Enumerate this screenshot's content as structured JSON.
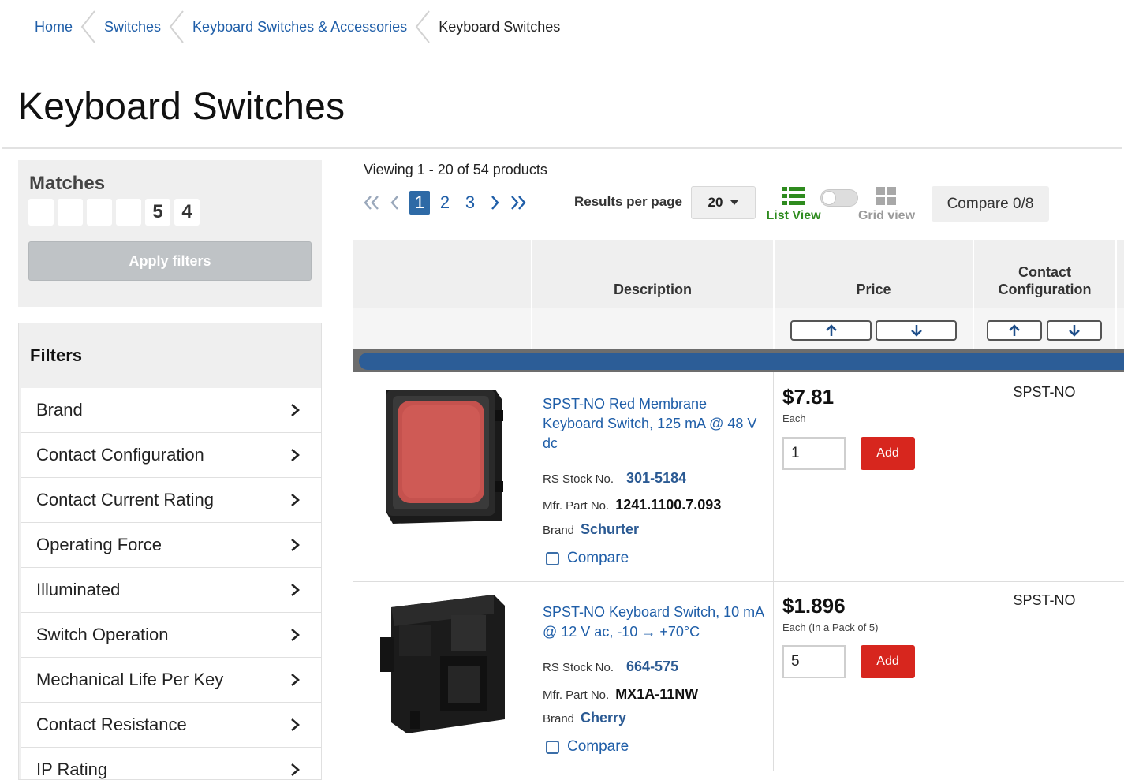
{
  "breadcrumb": {
    "items": [
      "Home",
      "Switches",
      "Keyboard Switches & Accessories"
    ],
    "current": "Keyboard Switches"
  },
  "page_title": "Keyboard Switches",
  "matches": {
    "label": "Matches",
    "digits": [
      "",
      "",
      "",
      "",
      "5",
      "4"
    ],
    "apply_label": "Apply filters"
  },
  "filters": {
    "title": "Filters",
    "items": [
      "Brand",
      "Contact Configuration",
      "Contact Current Rating",
      "Operating Force",
      "Illuminated",
      "Switch Operation",
      "Mechanical Life Per Key",
      "Contact Resistance",
      "IP Rating"
    ]
  },
  "results": {
    "viewing": "Viewing 1 - 20 of 54 products",
    "pages": [
      "1",
      "2",
      "3"
    ],
    "active_page": "1",
    "per_page_label": "Results per page",
    "per_page_value": "20",
    "list_view_label": "List View",
    "grid_view_label": "Grid view",
    "compare_label": "Compare 0/8"
  },
  "table": {
    "headers": {
      "description": "Description",
      "price": "Price",
      "contact_line1": "Contact",
      "contact_line2": "Configuration"
    }
  },
  "products": [
    {
      "title": "SPST-NO Red Membrane Keyboard Switch, 125 mA @ 48 V dc",
      "rs_label": "RS Stock No.",
      "rs_no": "301-5184",
      "mfr_label": "Mfr. Part No.",
      "mfr_no": "1241.1100.7.093",
      "brand_label": "Brand",
      "brand": "Schurter",
      "compare": "Compare",
      "price": "$7.81",
      "price_unit": "Each",
      "qty": "1",
      "add": "Add",
      "contact": "SPST-NO"
    },
    {
      "title": "SPST-NO Keyboard Switch, 10 mA @ 12 V ac, -10 → +70°C",
      "rs_label": "RS Stock No.",
      "rs_no": "664-575",
      "mfr_label": "Mfr. Part No.",
      "mfr_no": "MX1A-11NW",
      "brand_label": "Brand",
      "brand": "Cherry",
      "compare": "Compare",
      "price": "$1.896",
      "price_unit": "Each (In a Pack of 5)",
      "qty": "5",
      "add": "Add",
      "contact": "SPST-NO"
    }
  ],
  "colors": {
    "link": "#1f5ea8",
    "accent_blue": "#2c5d97",
    "add_red": "#d7261e",
    "list_view_green": "#2e8b1e"
  },
  "icons": [
    "chevron-left-icon",
    "chevron-right-icon",
    "double-chevron-left-icon",
    "double-chevron-right-icon",
    "list-view-icon",
    "grid-view-icon",
    "arrow-up-icon",
    "arrow-down-icon",
    "caret-down-icon"
  ]
}
